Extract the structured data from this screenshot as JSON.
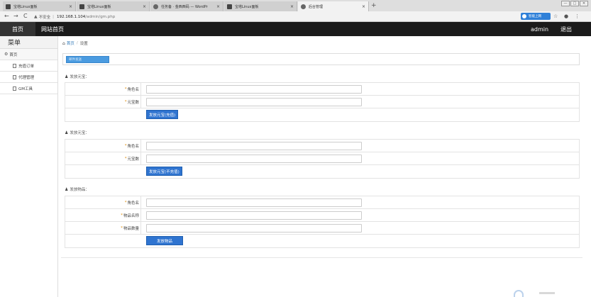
{
  "browser": {
    "tabs": [
      {
        "label": "宝塔Linux面板",
        "active": false,
        "icon": "panel-icon"
      },
      {
        "label": "宝塔Linux面板",
        "active": false,
        "icon": "panel-icon"
      },
      {
        "label": "任务备 · 金西西码 — WordPr",
        "active": false,
        "icon": "wordpress-icon"
      },
      {
        "label": "宝塔Linux面板",
        "active": false,
        "icon": "panel-icon"
      },
      {
        "label": "后台管理",
        "active": true,
        "icon": "globe-icon"
      }
    ],
    "tab_close": "×",
    "new_tab": "+",
    "window_controls": [
      "—",
      "□",
      "✕"
    ],
    "nav_back": "←",
    "nav_forward": "→",
    "nav_reload": "C",
    "security_icon": "warning-icon",
    "security_text": "不安全",
    "url_separator": "|",
    "url_host": "192.168.1.104",
    "url_path": "/admin/gm.php",
    "extension_label": "智能上网",
    "star_icon": "☆",
    "account_icon": "account-icon",
    "menu_icon": "⋮"
  },
  "topnav": {
    "home": "首页",
    "site_home": "网站首页",
    "username": "admin",
    "logout": "退出"
  },
  "sidebar": {
    "title": "菜单",
    "group": "首页",
    "items": [
      {
        "label": "充值订单"
      },
      {
        "label": "代理管理"
      },
      {
        "label": "GM工具"
      }
    ]
  },
  "breadcrumb": {
    "home": "首页",
    "separator": "/",
    "current": "设置"
  },
  "top_panel": {
    "button_label": "邮件发送"
  },
  "sections": [
    {
      "title": "发放元宝：",
      "fields": [
        {
          "label": "角色名",
          "value": ""
        },
        {
          "label": "元宝数",
          "value": ""
        }
      ],
      "button": "发放元宝(充值)"
    },
    {
      "title": "发放元宝：",
      "fields": [
        {
          "label": "角色名",
          "value": ""
        },
        {
          "label": "元宝数",
          "value": ""
        }
      ],
      "button": "发放元宝(不充值)"
    },
    {
      "title": "发放物品：",
      "fields": [
        {
          "label": "角色名",
          "value": ""
        },
        {
          "label": "物品名称",
          "value": ""
        },
        {
          "label": "物品数量",
          "value": ""
        }
      ],
      "button": "发放物品"
    }
  ],
  "required_mark": "*",
  "colors": {
    "topnav_bg": "#1b1b1b",
    "primary_button": "#2f74d0",
    "required_star": "#e08a00",
    "link": "#337ab7"
  }
}
